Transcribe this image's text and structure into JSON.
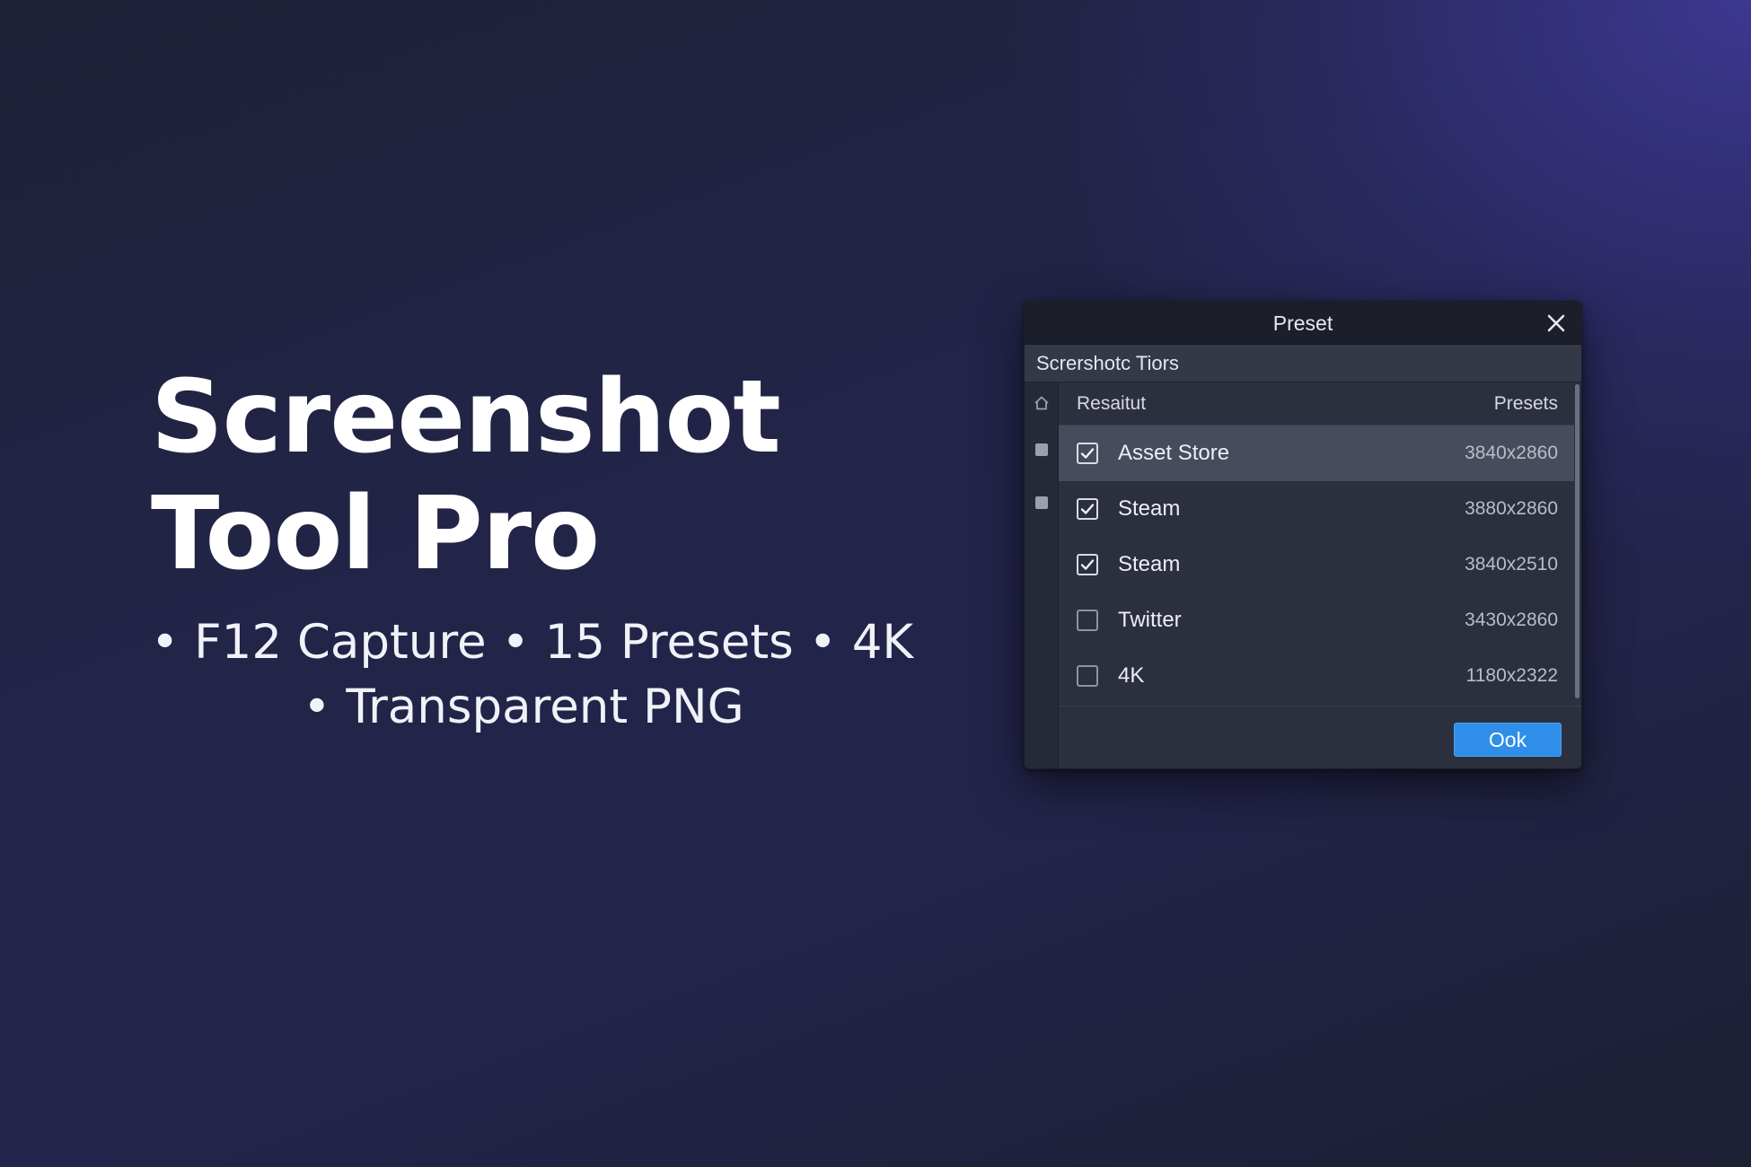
{
  "hero": {
    "title_line1": "Screenshot",
    "title_line2": "Tool Pro",
    "features_line1": "• F12 Capture • 15 Presets • 4K",
    "features_line2": "• Transparent PNG"
  },
  "dialog": {
    "title": "Preset",
    "subtitle": "Scrershotc Tiors",
    "header_left": "Resaitut",
    "header_right": "Presets",
    "rows": [
      {
        "name": "Asset Store",
        "resolution": "3840x2860",
        "checked": true,
        "selected": true
      },
      {
        "name": "Steam",
        "resolution": "3880x2860",
        "checked": true,
        "selected": false
      },
      {
        "name": "Steam",
        "resolution": "3840x2510",
        "checked": true,
        "selected": false
      },
      {
        "name": "Twitter",
        "resolution": "3430x2860",
        "checked": false,
        "selected": false
      },
      {
        "name": "4K",
        "resolution": "1180x2322",
        "checked": false,
        "selected": false
      }
    ],
    "ok_label": "Ook"
  },
  "icons": {
    "close": "close-icon",
    "home": "home-icon",
    "check": "checkmark-icon"
  },
  "colors": {
    "accent": "#2f8fe8",
    "dialog_bg": "#2b2f3e",
    "titlebar_bg": "#1c1f29",
    "selected_row": "#474c5c"
  }
}
